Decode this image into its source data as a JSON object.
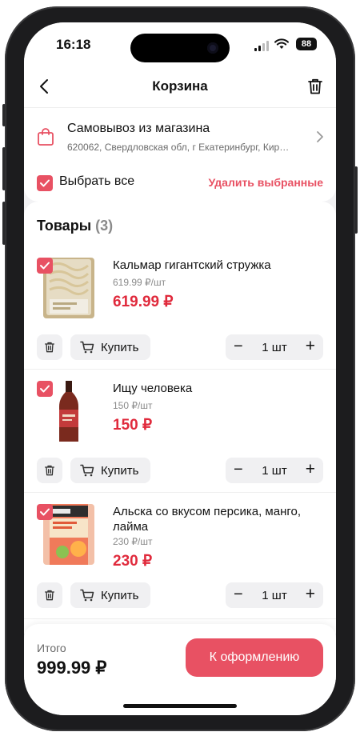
{
  "status_bar": {
    "time": "16:18",
    "battery": "88"
  },
  "header": {
    "title": "Корзина",
    "back_icon": "chevron-left-icon",
    "trash_icon": "trash-icon"
  },
  "pickup": {
    "title": "Самовывоз из магазина",
    "address": "620062, Свердловская обл, г Екатеринбург, Кир…",
    "icon": "shopping-bag-icon"
  },
  "select_all": {
    "label": "Выбрать все",
    "checked": true,
    "delete_label": "Удалить выбранные"
  },
  "goods": {
    "title": "Товары",
    "count": "(3)",
    "items": [
      {
        "name": "Кальмар гигантский стружка",
        "unit_price": "619.99 ₽/шт",
        "price": "619.99 ₽",
        "buy_label": "Купить",
        "qty": "1 шт",
        "minus": "−",
        "plus": "+"
      },
      {
        "name": "Ищу человека",
        "unit_price": "150 ₽/шт",
        "price": "150 ₽",
        "buy_label": "Купить",
        "qty": "1 шт",
        "minus": "−",
        "plus": "+"
      },
      {
        "name": "Альска со вкусом персика, манго, лайма",
        "unit_price": "230 ₽/шт",
        "price": "230 ₽",
        "buy_label": "Купить",
        "qty": "1 шт",
        "minus": "−",
        "plus": "+"
      }
    ]
  },
  "footer": {
    "total_label": "Итого",
    "total_value": "999.99 ₽",
    "checkout_label": "К оформлению"
  },
  "colors": {
    "accent": "#e85163",
    "price": "#e02a3c"
  }
}
